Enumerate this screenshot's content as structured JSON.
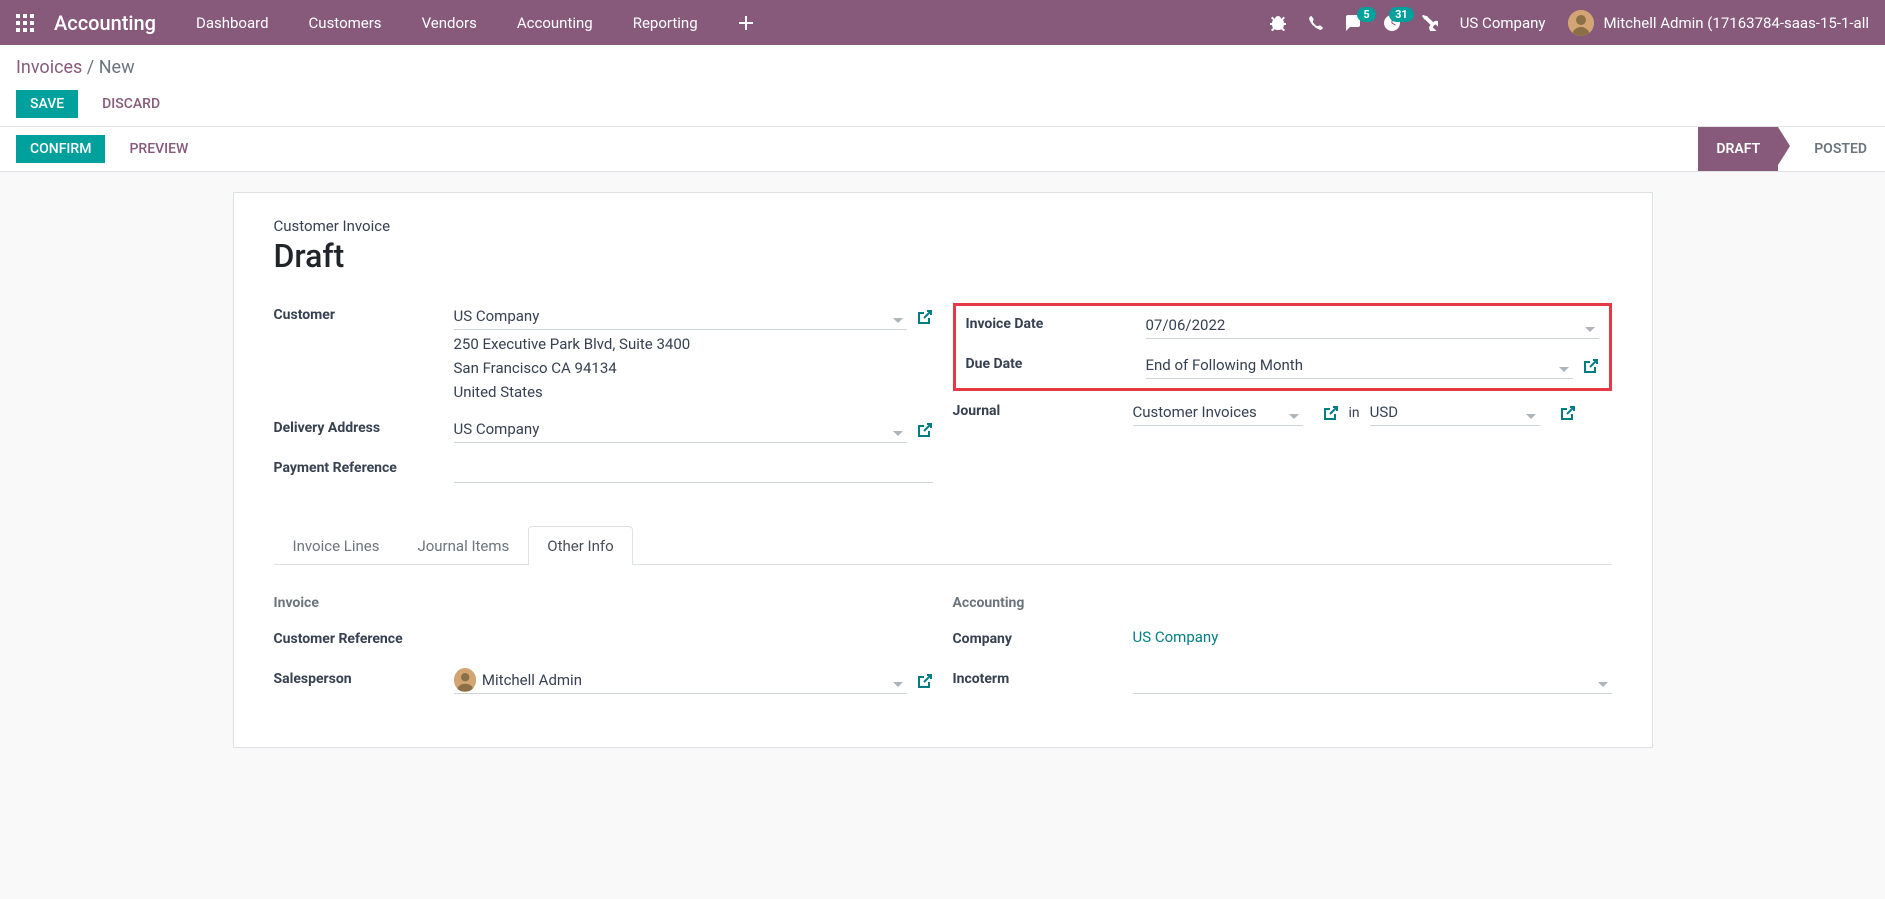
{
  "nav": {
    "app": "Accounting",
    "items": [
      "Dashboard",
      "Customers",
      "Vendors",
      "Accounting",
      "Reporting"
    ],
    "message_count": "5",
    "activity_count": "31",
    "company": "US Company",
    "user": "Mitchell Admin (17163784-saas-15-1-all"
  },
  "breadcrumb": {
    "parent": "Invoices",
    "current": "New"
  },
  "buttons": {
    "save": "SAVE",
    "discard": "DISCARD",
    "confirm": "CONFIRM",
    "preview": "PREVIEW"
  },
  "status": {
    "draft": "DRAFT",
    "posted": "POSTED"
  },
  "form": {
    "type_label": "Customer Invoice",
    "title": "Draft",
    "left": {
      "customer_label": "Customer",
      "customer_value": "US Company",
      "address_line1": "250 Executive Park Blvd, Suite 3400",
      "address_line2": "San Francisco CA 94134",
      "address_line3": "United States",
      "delivery_label": "Delivery Address",
      "delivery_value": "US Company",
      "payref_label": "Payment Reference",
      "payref_value": ""
    },
    "right": {
      "invdate_label": "Invoice Date",
      "invdate_value": "07/06/2022",
      "duedate_label": "Due Date",
      "duedate_value": "End of Following Month",
      "journal_label": "Journal",
      "journal_value": "Customer Invoices",
      "in_label": "in",
      "currency_value": "USD"
    }
  },
  "tabs": {
    "lines": "Invoice Lines",
    "journal": "Journal Items",
    "other": "Other Info"
  },
  "other": {
    "invoice_section": "Invoice",
    "custref_label": "Customer Reference",
    "sales_label": "Salesperson",
    "sales_value": "Mitchell Admin",
    "accounting_section": "Accounting",
    "company_label": "Company",
    "company_value": "US Company",
    "incoterm_label": "Incoterm",
    "incoterm_value": ""
  }
}
